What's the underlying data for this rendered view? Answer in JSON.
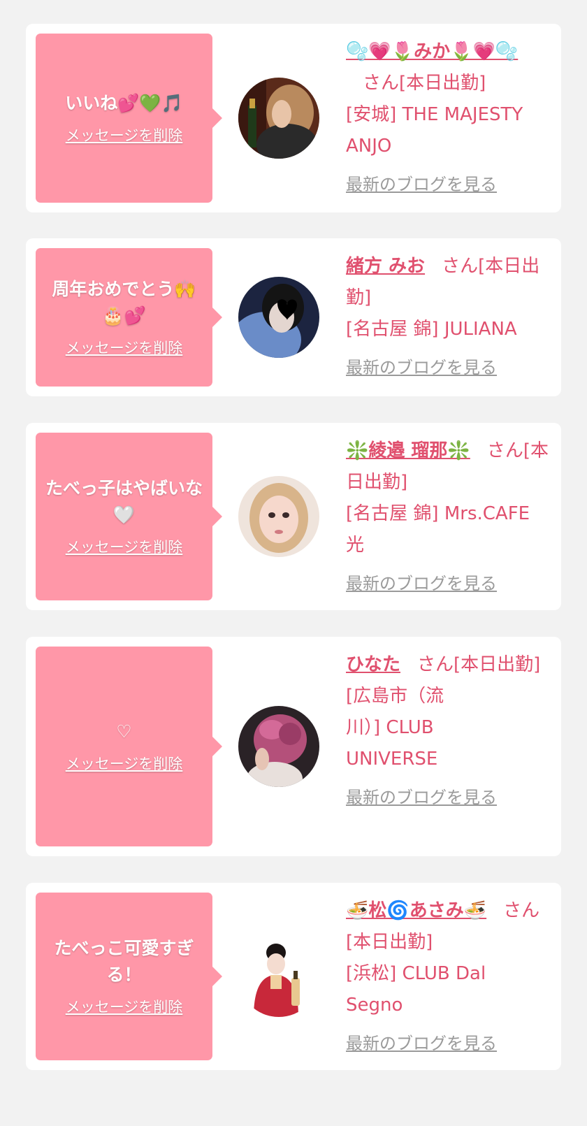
{
  "messages": [
    {
      "message": "いいね💕💚🎵",
      "delete_label": "メッセージを削除",
      "cast_name": "🫧💗🌷みか🌷💗🫧",
      "san_status": "さん[本日出勤]",
      "shop": "[安城] THE MAJESTY ANJO",
      "blog_label": "最新のブログを見る",
      "avatar_icon": "woman-photo-brown-hair"
    },
    {
      "message": "周年おめでとう🙌🎂💕",
      "delete_label": "メッセージを削除",
      "cast_name": "緒方 みお",
      "san_status": "さん[本日出勤]",
      "shop": "[名古屋 錦] JULIANA",
      "blog_label": "最新のブログを見る",
      "avatar_icon": "woman-photo-blue-masked"
    },
    {
      "message": "たべっ子はやばいな🤍",
      "delete_label": "メッセージを削除",
      "cast_name": "❇️綾邉 瑠那❇️",
      "san_status": "さん[本日出勤]",
      "shop": "[名古屋 錦] Mrs.CAFE 光",
      "blog_label": "最新のブログを見る",
      "avatar_icon": "woman-photo-blonde"
    },
    {
      "message": "♡",
      "delete_label": "メッセージを削除",
      "cast_name": "ひなた",
      "san_status": "さん[本日出勤]",
      "shop": "[広島市（流川）] CLUB UNIVERSE",
      "blog_label": "最新のブログを見る",
      "avatar_icon": "woman-photo-pink-hair"
    },
    {
      "message": "たべっこ可愛すぎる！",
      "delete_label": "メッセージを削除",
      "cast_name": "🍜松🌀あさみ🍜",
      "san_status": "さん[本日出勤]",
      "shop": "[浜松] CLUB Dal Segno",
      "blog_label": "最新のブログを見る",
      "avatar_icon": "woman-photo-red-kimono"
    }
  ],
  "colors": {
    "page_background": "#f2f2f2",
    "bubble_pink": "#ff97a8",
    "accent_text": "#e0506e",
    "link_gray": "#9a9a9a"
  }
}
